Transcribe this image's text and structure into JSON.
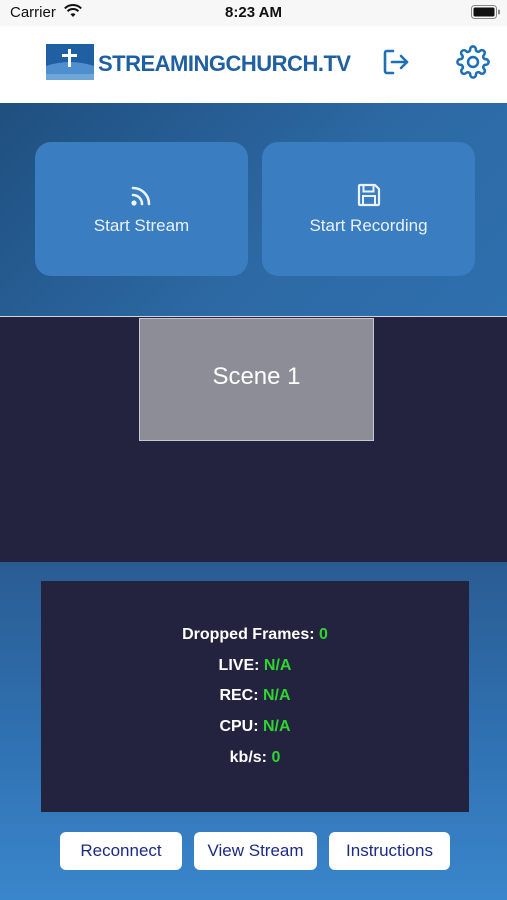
{
  "status_bar": {
    "carrier": "Carrier",
    "time": "8:23 AM"
  },
  "header": {
    "logo_text": "STREAMINGCHURCH.TV",
    "icons": {
      "logout": "logout-icon",
      "settings": "gear-icon"
    },
    "brand_color": "#1f5fa2"
  },
  "controls": {
    "start_stream": {
      "label": "Start Stream",
      "icon": "broadcast-icon"
    },
    "start_recording": {
      "label": "Start Recording",
      "icon": "save-icon"
    }
  },
  "scenes": [
    {
      "label": "Scene 1"
    }
  ],
  "stats": {
    "dropped_frames": {
      "label": "Dropped Frames:",
      "value": "0"
    },
    "live": {
      "label": "LIVE:",
      "value": "N/A"
    },
    "rec": {
      "label": "REC:",
      "value": "N/A"
    },
    "cpu": {
      "label": "CPU:",
      "value": "N/A"
    },
    "kbps": {
      "label": "kb/s:",
      "value": "0"
    },
    "value_color": "#2fd52f"
  },
  "footer_buttons": {
    "reconnect": "Reconnect",
    "view_stream": "View Stream",
    "instructions": "Instructions"
  }
}
